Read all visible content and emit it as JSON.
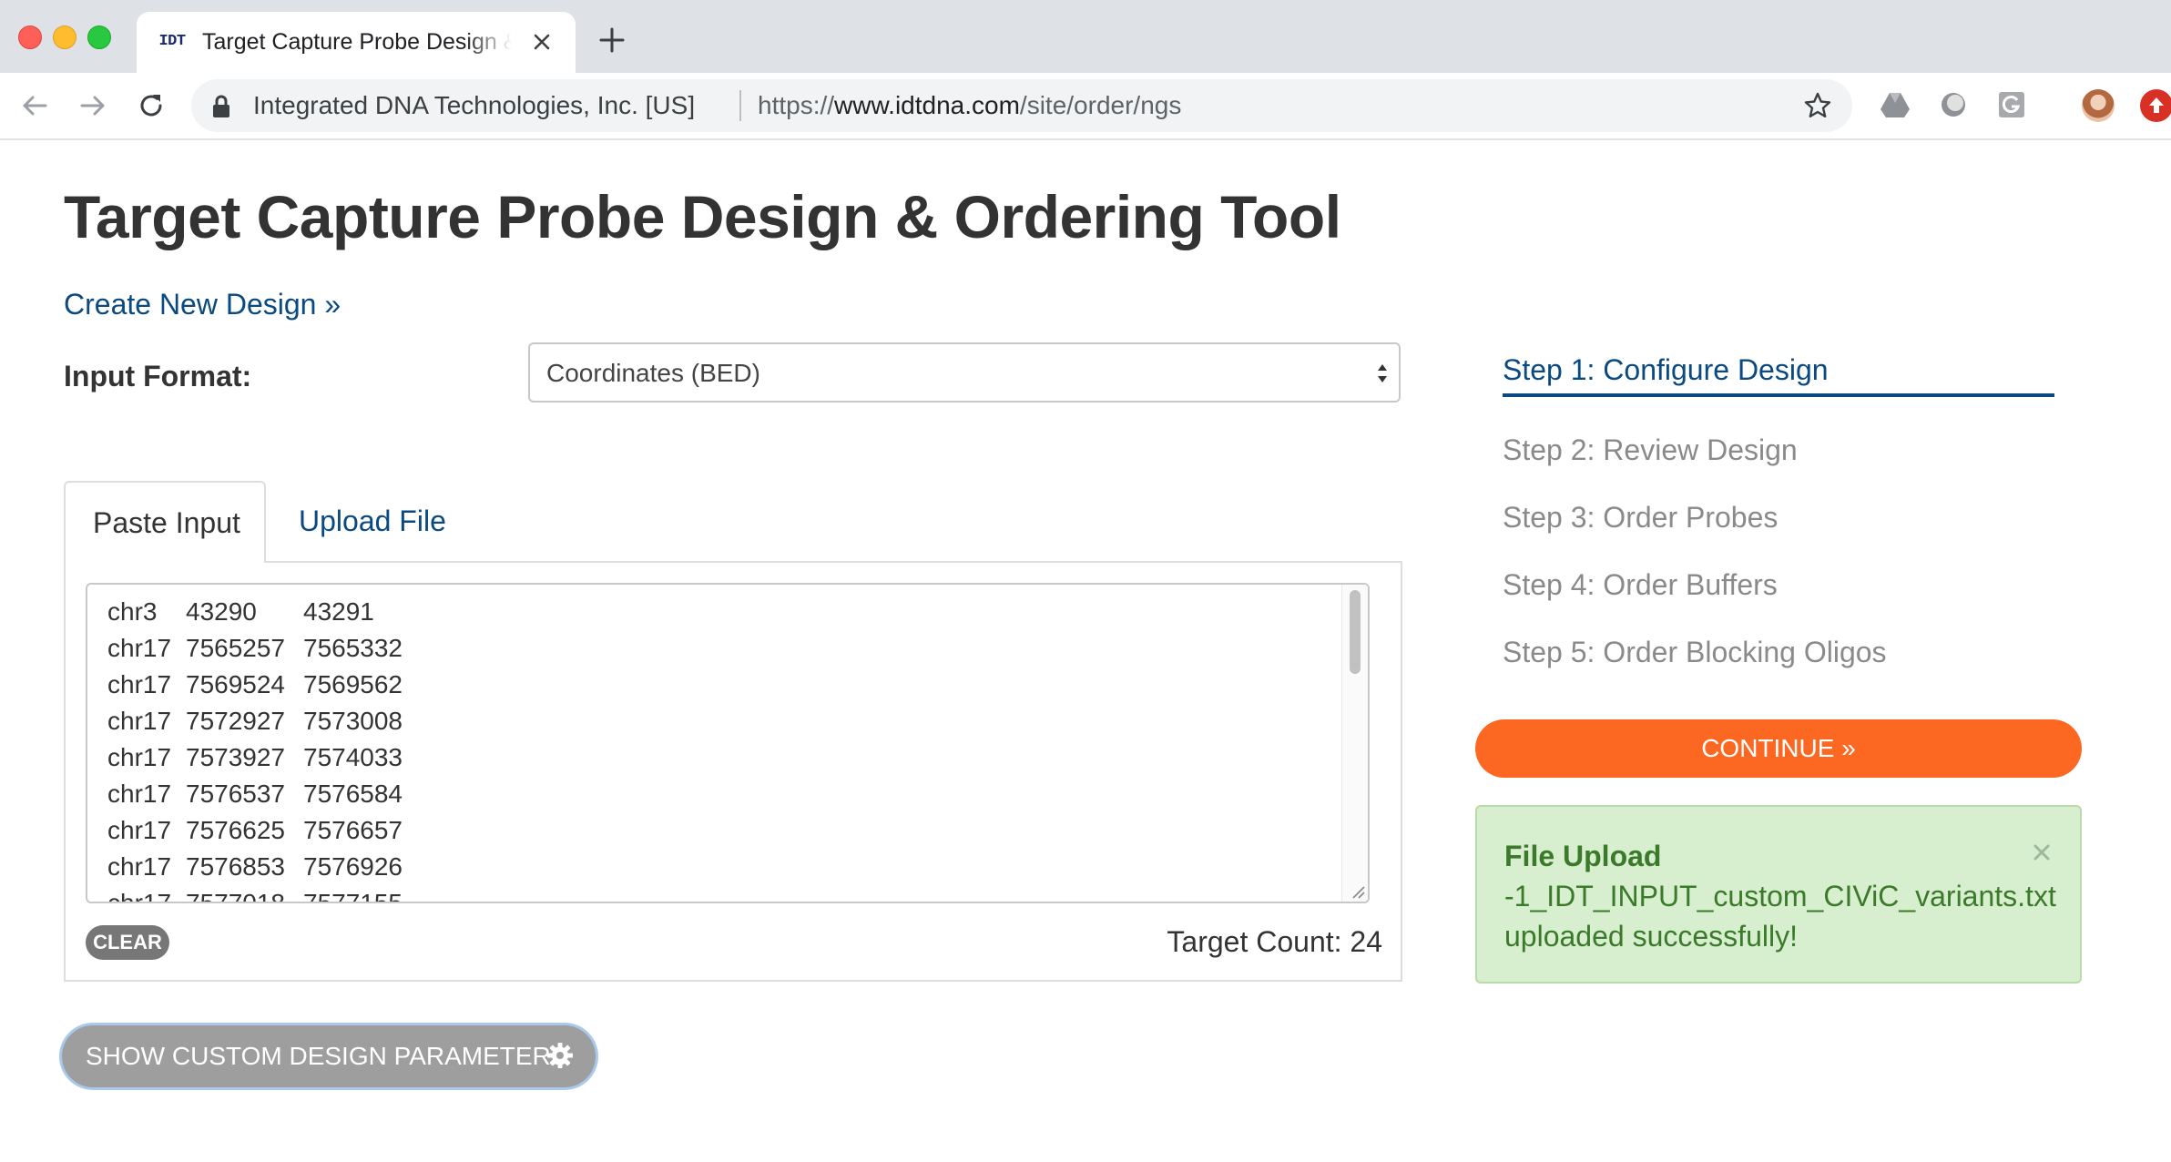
{
  "browser": {
    "tab_favicon": "IDT",
    "tab_title": "Target Capture Probe Design & Ordering Tool",
    "site_identity": "Integrated DNA Technologies, Inc. [US]",
    "url_scheme": "https://",
    "url_host": "www.idtdna.com",
    "url_path": "/site/order/ngs"
  },
  "page": {
    "title": "Target Capture Probe Design & Ordering Tool",
    "create_link": "Create New Design »",
    "input_format_label": "Input Format:",
    "input_format_value": "Coordinates (BED)"
  },
  "input_tabs": {
    "paste": "Paste Input",
    "upload": "Upload File"
  },
  "bed_rows": [
    [
      "chr3",
      "43290",
      "43291"
    ],
    [
      "chr17",
      "7565257",
      "7565332"
    ],
    [
      "chr17",
      "7569524",
      "7569562"
    ],
    [
      "chr17",
      "7572927",
      "7573008"
    ],
    [
      "chr17",
      "7573927",
      "7574033"
    ],
    [
      "chr17",
      "7576537",
      "7576584"
    ],
    [
      "chr17",
      "7576625",
      "7576657"
    ],
    [
      "chr17",
      "7576853",
      "7576926"
    ],
    [
      "chr17",
      "7577018",
      "7577155"
    ]
  ],
  "input_panel": {
    "clear_label": "CLEAR",
    "target_count": "Target Count: 24"
  },
  "custom_params_button": "SHOW CUSTOM DESIGN PARAMETERS",
  "steps": [
    "Step 1: Configure Design",
    "Step 2: Review Design",
    "Step 3: Order Probes",
    "Step 4: Order Buffers",
    "Step 5: Order Blocking Oligos"
  ],
  "continue_label": "CONTINUE »",
  "alert": {
    "title": "File Upload",
    "line1": "-1_IDT_INPUT_custom_CIViC_variants.txt",
    "line2": "uploaded successfully!"
  },
  "colors": {
    "link_blue": "#0a4a80",
    "accent_orange": "#fc6722",
    "success_green": "#3a7a2a",
    "success_bg": "#d7eecf"
  },
  "icons": [
    "back-arrow-icon",
    "forward-arrow-icon",
    "reload-icon",
    "lock-icon",
    "star-icon",
    "gear-icon",
    "close-icon"
  ]
}
